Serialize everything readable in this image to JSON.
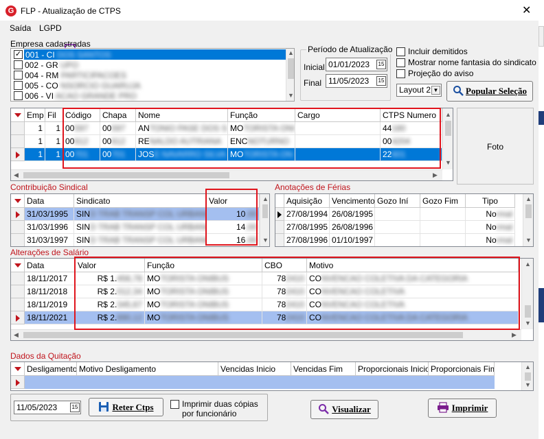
{
  "window": {
    "title": "FLP - Atualização de CTPS",
    "logo": "G"
  },
  "menu": {
    "saida": "Saída",
    "lgpd": "LGPD"
  },
  "empresas": {
    "label": "Empresa cadastradas",
    "items": [
      {
        "code": "001 - CI",
        "checked": true,
        "selected": true
      },
      {
        "code": "002 - GR",
        "checked": false
      },
      {
        "code": "004 - RM",
        "checked": false
      },
      {
        "code": "005 - CO",
        "checked": false
      },
      {
        "code": "006 - VI",
        "checked": false
      }
    ]
  },
  "periodo": {
    "title": "Período de Atualização",
    "inicial_label": "Inicial",
    "inicial": "01/01/2023",
    "final_label": "Final",
    "final": "11/05/2023"
  },
  "options": {
    "incluir_demitidos": "Incluir demitidos",
    "mostrar_nome": "Mostrar nome fantasia do sindicato",
    "projecao": "Projeção do aviso",
    "layout": "Layout 2"
  },
  "buttons": {
    "popular": "Popular Seleção",
    "reter": "Reter Ctps",
    "visualizar": "Visualizar",
    "imprimir": "Imprimir"
  },
  "foto": "Foto",
  "funcionarios": {
    "headers": [
      "Emp",
      "Fil",
      "Código",
      "Chapa",
      "Nome",
      "Função",
      "Cargo",
      "CTPS Numero"
    ],
    "rows": [
      {
        "emp": "1",
        "fil": "1",
        "codigo": "00",
        "chapa": "00",
        "nome": "AN",
        "funcao": "MO",
        "cargo": "",
        "ctps": "44"
      },
      {
        "emp": "1",
        "fil": "1",
        "codigo": "00",
        "chapa": "00",
        "nome": "RE",
        "funcao": "ENC",
        "cargo": "",
        "ctps": "00"
      },
      {
        "emp": "1",
        "fil": "1",
        "codigo": "00",
        "chapa": "00",
        "nome": "JOS",
        "funcao": "MO",
        "cargo": "",
        "ctps": "22"
      }
    ]
  },
  "contribuicao": {
    "title": "Contribuição Sindical",
    "headers": [
      "Data",
      "Sindicato",
      "Valor"
    ],
    "rows": [
      {
        "data": "31/03/1995",
        "sindicato": "SIN",
        "valor": "10"
      },
      {
        "data": "31/03/1996",
        "sindicato": "SIN",
        "valor": "14"
      },
      {
        "data": "31/03/1997",
        "sindicato": "SIN",
        "valor": "16"
      }
    ]
  },
  "ferias": {
    "title": "Anotações de Férias",
    "headers": [
      "Aquisição",
      "Vencimento",
      "Gozo Iní",
      "Gozo Fim",
      "Tipo"
    ],
    "rows": [
      {
        "aquisicao": "27/08/1994",
        "vencimento": "26/08/1995",
        "tipo": "No"
      },
      {
        "aquisicao": "27/08/1995",
        "vencimento": "26/08/1996",
        "tipo": "No"
      },
      {
        "aquisicao": "27/08/1996",
        "vencimento": "01/10/1997",
        "tipo": "No"
      }
    ]
  },
  "salario": {
    "title": "Alterações de Salário",
    "headers": [
      "Data",
      "Valor",
      "Função",
      "CBO",
      "Motivo"
    ],
    "rows": [
      {
        "data": "18/11/2017",
        "valor": "R$ 1.",
        "funcao": "MO",
        "cbo": "78",
        "motivo": "CO"
      },
      {
        "data": "18/11/2018",
        "valor": "R$ 2.",
        "funcao": "MO",
        "cbo": "78",
        "motivo": "CO"
      },
      {
        "data": "18/11/2019",
        "valor": "R$ 2.",
        "funcao": "MO",
        "cbo": "78",
        "motivo": "CO"
      },
      {
        "data": "18/11/2021",
        "valor": "R$ 2.",
        "funcao": "MO",
        "cbo": "78",
        "motivo": "CO"
      }
    ]
  },
  "quitacao": {
    "title": "Dados da Quitação",
    "headers": [
      "Desligamento",
      "Motivo Desligamento",
      "Vencidas Inicio",
      "Vencidas Fim",
      "Proporcionais Inicio",
      "Proporcionais Fim"
    ]
  },
  "bottom": {
    "date": "11/05/2023",
    "imprimir_duas": "Imprimir duas cópias",
    "por_func": "por funcionário"
  },
  "colors": {
    "accent_red": "#c0141c",
    "select_blue": "#0078d7",
    "soft_blue": "#a4bff0"
  }
}
